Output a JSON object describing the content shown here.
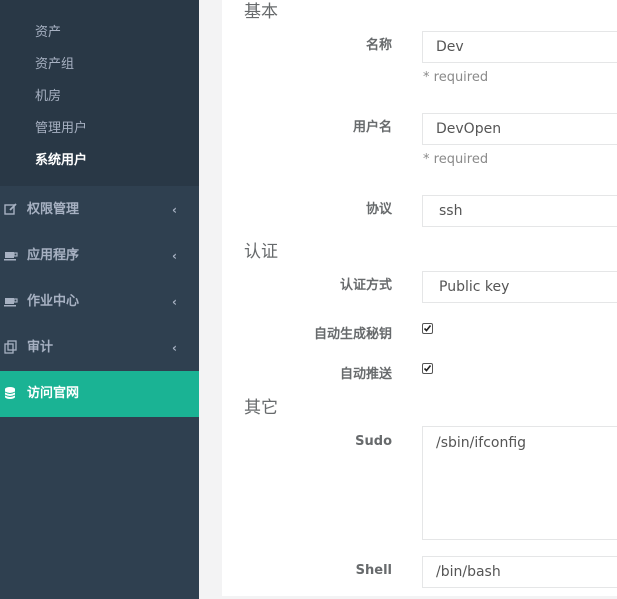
{
  "sidebar": {
    "submenu": [
      {
        "label": "资产",
        "active": false
      },
      {
        "label": "资产组",
        "active": false
      },
      {
        "label": "机房",
        "active": false
      },
      {
        "label": "管理用户",
        "active": false
      },
      {
        "label": "系统用户",
        "active": true
      }
    ],
    "menu": [
      {
        "label": "权限管理",
        "icon": "edit-icon",
        "arrow": "‹"
      },
      {
        "label": "应用程序",
        "icon": "coffee-icon",
        "arrow": "‹"
      },
      {
        "label": "作业中心",
        "icon": "coffee-icon",
        "arrow": "‹"
      },
      {
        "label": "审计",
        "icon": "copy-icon",
        "arrow": "‹"
      },
      {
        "label": "访问官网",
        "icon": "database-icon"
      }
    ]
  },
  "form": {
    "sections": {
      "basic": "基本",
      "auth": "认证",
      "other": "其它"
    },
    "name": {
      "label": "名称",
      "value": "Dev",
      "help": "* required"
    },
    "username": {
      "label": "用户名",
      "value": "DevOpen",
      "help": "* required"
    },
    "protocol": {
      "label": "协议",
      "value": "ssh"
    },
    "auth_method": {
      "label": "认证方式",
      "value": "Public key"
    },
    "auto_generate_key": {
      "label": "自动生成秘钥",
      "checked": true
    },
    "auto_push": {
      "label": "自动推送",
      "checked": true
    },
    "sudo": {
      "label": "Sudo",
      "value": "/sbin/ifconfig"
    },
    "shell": {
      "label": "Shell",
      "value": "/bin/bash"
    }
  }
}
